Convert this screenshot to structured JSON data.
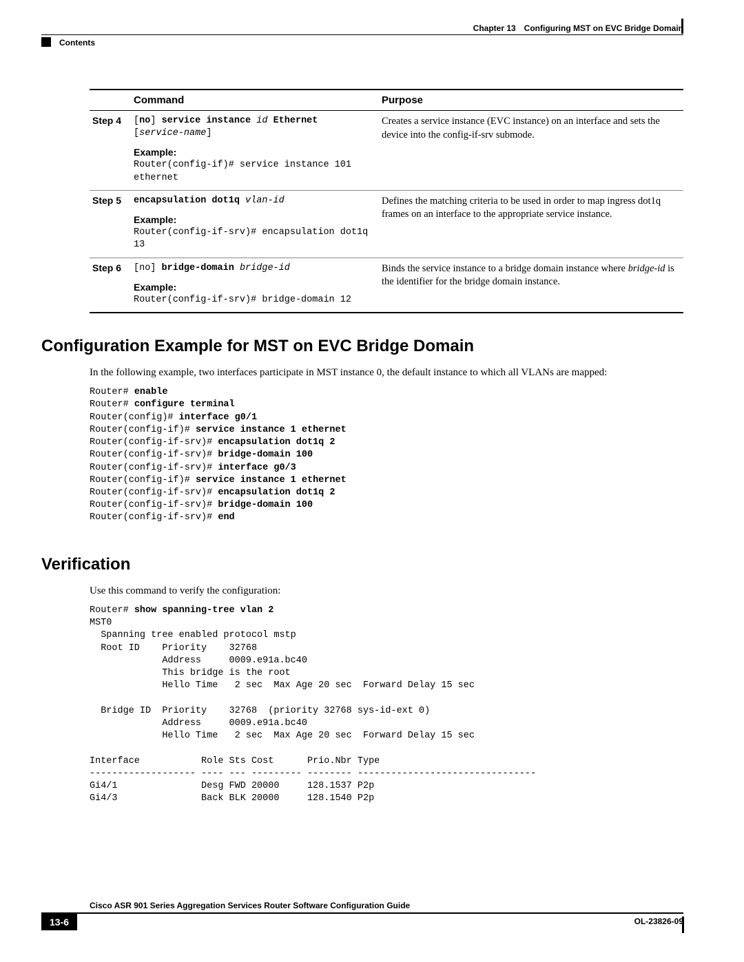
{
  "header": {
    "chapter_line": "Chapter 13 Configuring MST on EVC Bridge Domain",
    "contents_label": "Contents"
  },
  "table": {
    "headers": {
      "command": "Command",
      "purpose": "Purpose"
    },
    "step4": {
      "label": "Step 4",
      "cmd_plain_a": "[",
      "cmd_bold_a": "no",
      "cmd_plain_b": "] ",
      "cmd_bold_b": "service instance",
      "cmd_space1": " ",
      "cmd_ital_a": "id",
      "cmd_space2": " ",
      "cmd_bold_c": "Ethernet",
      "cmd_line2_a": "[",
      "cmd_line2_b": "service-name",
      "cmd_line2_c": "]",
      "example_label": "Example:",
      "example_text": "Router(config-if)# service instance 101 ethernet",
      "purpose": "Creates a service instance (EVC instance) on an interface and sets the device into the config-if-srv submode."
    },
    "step5": {
      "label": "Step 5",
      "cmd_bold": "encapsulation dot1q",
      "cmd_space": " ",
      "cmd_ital": "vlan-id",
      "example_label": "Example:",
      "example_text": "Router(config-if-srv)# encapsulation dot1q 13",
      "purpose": "Defines the matching criteria to be used in order to map ingress dot1q frames on an interface to the appropriate service instance."
    },
    "step6": {
      "label": "Step 6",
      "cmd_plain_a": "[no] ",
      "cmd_bold": "bridge-domain",
      "cmd_space": " ",
      "cmd_ital": "bridge-id",
      "example_label": "Example:",
      "example_text": "Router(config-if-srv)# bridge-domain 12",
      "purpose_a": "Binds the service instance to a bridge domain instance where ",
      "purpose_i": "bridge-id",
      "purpose_b": " is the identifier for the bridge domain instance."
    }
  },
  "section1": {
    "heading": "Configuration Example for MST on EVC Bridge Domain",
    "para": "In the following example, two interfaces participate in MST instance 0, the default instance to which all VLANs are mapped:",
    "code": {
      "l1p": "Router# ",
      "l1b": "enable",
      "l2p": "Router# ",
      "l2b": "configure terminal",
      "l3p": "Router(config)# ",
      "l3b": "interface g0/1",
      "l4p": "Router(config-if)# ",
      "l4b": "service instance 1 ethernet",
      "l5p": "Router(config-if-srv)# ",
      "l5b": "encapsulation dot1q 2",
      "l6p": "Router(config-if-srv)# ",
      "l6b": "bridge-domain 100",
      "l7p": "Router(config-if-srv)# ",
      "l7b": "interface g0/3",
      "l8p": "Router(config-if)# ",
      "l8b": "service instance 1 ethernet",
      "l9p": "Router(config-if-srv)# ",
      "l9b": "encapsulation dot1q 2",
      "l10p": "Router(config-if-srv)# ",
      "l10b": "bridge-domain 100",
      "l11p": "Router(config-if-srv)# ",
      "l11b": "end"
    }
  },
  "section2": {
    "heading": "Verification",
    "para": "Use this command to verify the configuration:",
    "code": {
      "l1p": "Router# ",
      "l1b": "show spanning-tree vlan 2",
      "rest": "\nMST0\n  Spanning tree enabled protocol mstp\n  Root ID    Priority    32768\n             Address     0009.e91a.bc40\n             This bridge is the root\n             Hello Time   2 sec  Max Age 20 sec  Forward Delay 15 sec\n\n  Bridge ID  Priority    32768  (priority 32768 sys-id-ext 0)\n             Address     0009.e91a.bc40\n             Hello Time   2 sec  Max Age 20 sec  Forward Delay 15 sec\n\nInterface           Role Sts Cost      Prio.Nbr Type\n------------------- ---- --- --------- -------- --------------------------------\nGi4/1               Desg FWD 20000     128.1537 P2p\nGi4/3               Back BLK 20000     128.1540 P2p"
    }
  },
  "footer": {
    "guide_title": "Cisco ASR 901 Series Aggregation Services Router Software Configuration Guide",
    "page_num": "13-6",
    "doc_id": "OL-23826-09"
  }
}
